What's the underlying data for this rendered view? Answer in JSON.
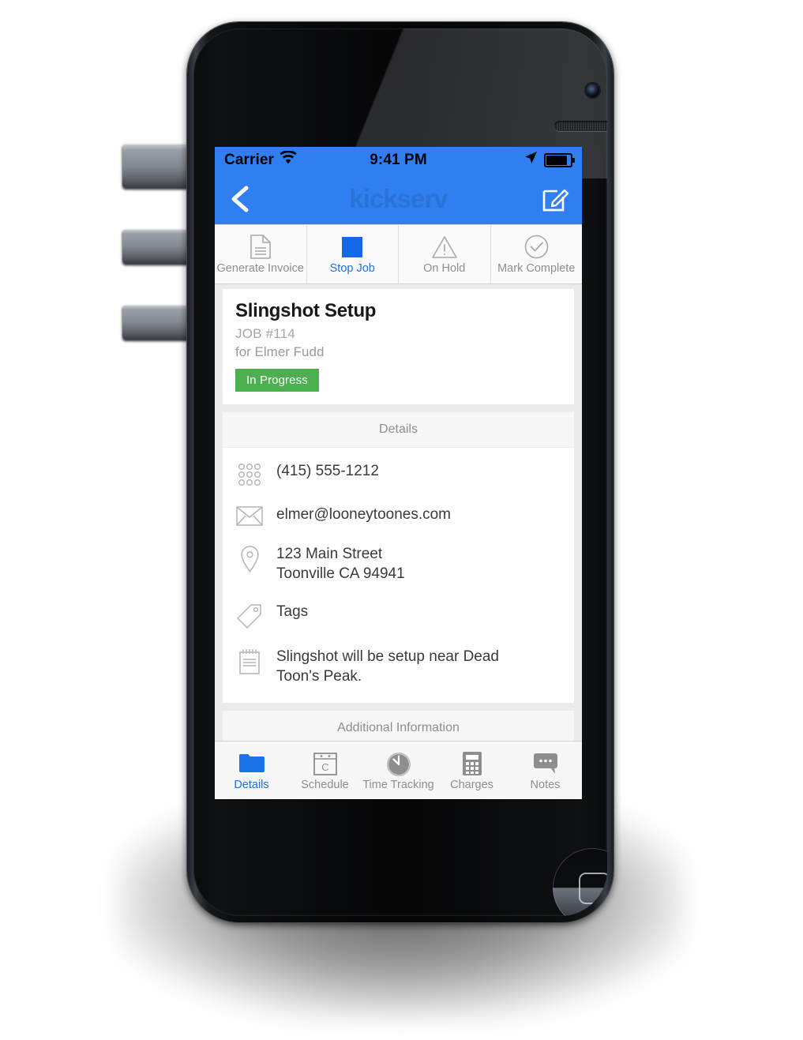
{
  "status_bar": {
    "carrier": "Carrier",
    "wifi_icon": "wifi-icon",
    "time": "9:41 PM",
    "location_icon": "location-arrow-icon",
    "battery_icon": "battery-full-icon"
  },
  "nav_bar": {
    "back_icon": "chevron-left-icon",
    "title": "kickserv",
    "edit_icon": "compose-icon"
  },
  "action_bar": {
    "actions": [
      {
        "label": "Generate Invoice",
        "icon": "document-icon",
        "active": false
      },
      {
        "label": "Stop Job",
        "icon": "stop-square-icon",
        "active": true
      },
      {
        "label": "On Hold",
        "icon": "warning-triangle-icon",
        "active": false
      },
      {
        "label": "Mark Complete",
        "icon": "check-circle-icon",
        "active": false
      }
    ]
  },
  "job_card": {
    "title": "Slingshot Setup",
    "job_number": "JOB #114",
    "customer": "for Elmer Fudd",
    "status_badge": "In Progress",
    "status_color": "#4cb050"
  },
  "details_section": {
    "header": "Details",
    "rows": [
      {
        "icon": "phone-keypad-icon",
        "text": "(415) 555-1212"
      },
      {
        "icon": "envelope-icon",
        "text": "elmer@looneytoones.com"
      },
      {
        "icon": "map-pin-icon",
        "line1": "123 Main Street",
        "line2": "Toonville CA 94941"
      },
      {
        "icon": "tag-icon",
        "text": "Tags"
      },
      {
        "icon": "notepad-icon",
        "line1": "Slingshot will be setup near Dead",
        "line2": "Toon's Peak."
      }
    ]
  },
  "additional_section": {
    "header": "Additional Information"
  },
  "tab_bar": {
    "tabs": [
      {
        "label": "Details",
        "icon": "folder-icon",
        "active": true
      },
      {
        "label": "Schedule",
        "icon": "calendar-icon",
        "active": false
      },
      {
        "label": "Time Tracking",
        "icon": "stopwatch-icon",
        "active": false
      },
      {
        "label": "Charges",
        "icon": "calculator-icon",
        "active": false
      },
      {
        "label": "Notes",
        "icon": "speech-bubble-icon",
        "active": false
      }
    ]
  },
  "device": {
    "camera_icon": "front-camera",
    "earpiece_icon": "earpiece-speaker",
    "home_button_icon": "home-button",
    "side_buttons": [
      "mute-switch",
      "volume-up-button",
      "volume-down-button"
    ]
  },
  "colors": {
    "accent_blue": "#2f7ff0",
    "link_blue": "#1a73e8",
    "status_green": "#4cb050"
  }
}
